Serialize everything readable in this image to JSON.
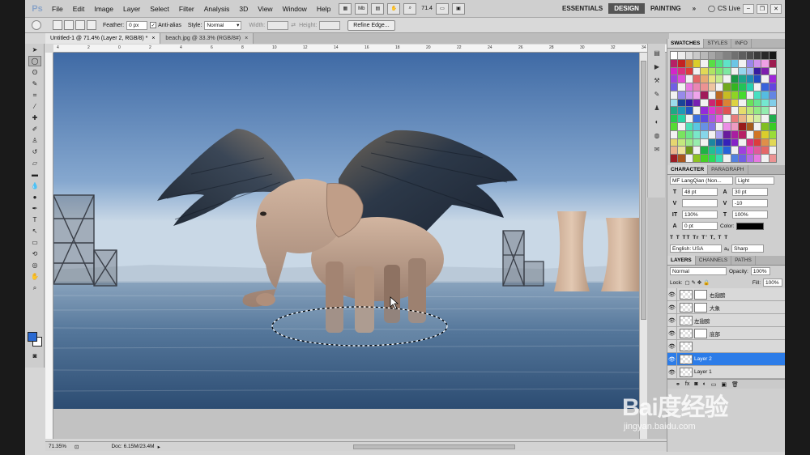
{
  "app": {
    "logo": "Ps"
  },
  "menu": [
    "File",
    "Edit",
    "Image",
    "Layer",
    "Select",
    "Filter",
    "Analysis",
    "3D",
    "View",
    "Window",
    "Help"
  ],
  "menubar": {
    "mb_label": "Mb",
    "zoom_value": "71.4",
    "workspaces": [
      "ESSENTIALS",
      "DESIGN",
      "PAINTING"
    ],
    "active_workspace": "DESIGN",
    "more": "»",
    "cs_live": "CS Live"
  },
  "options": {
    "feather_label": "Feather:",
    "feather_value": "0 px",
    "antialias_label": "Anti-alias",
    "style_label": "Style:",
    "style_value": "Normal",
    "width_label": "Width:",
    "height_label": "Height:",
    "refine_edge": "Refine Edge..."
  },
  "tabs": [
    {
      "label": "Untitled-1 @ 71.4% (Layer 2, RGB/8) *",
      "active": true
    },
    {
      "label": "beach.jpg @ 33.3% (RGB/8#)",
      "active": false
    }
  ],
  "ruler": [
    "4",
    "2",
    "0",
    "2",
    "4",
    "6",
    "8",
    "10",
    "12",
    "14",
    "16",
    "18",
    "20",
    "22",
    "24",
    "26",
    "28",
    "30",
    "32",
    "34"
  ],
  "status": {
    "zoom": "71.35%",
    "doc": "Doc: 6.15M/23.4M"
  },
  "swatches": {
    "tabs": [
      "SWATCHES",
      "STYLES",
      "INFO"
    ],
    "active": "SWATCHES"
  },
  "character": {
    "tabs": [
      "CHARACTER",
      "PARAGRAPH"
    ],
    "font_family": "MF LangQian (Non...",
    "font_style": "Light",
    "size": "48 pt",
    "leading": "30 pt",
    "tracking": "-10",
    "vscale": "130%",
    "hscale": "100%",
    "baseline": "0 pt",
    "color_label": "Color:",
    "language": "English: USA",
    "aa_label": "aₐ",
    "antialias": "Sharp",
    "text_styles": "T T TT Tr T' T, T T"
  },
  "layers": {
    "tabs": [
      "LAYERS",
      "CHANNELS",
      "PATHS"
    ],
    "blend_mode": "Normal",
    "opacity_label": "Opacity:",
    "opacity": "100%",
    "lock_label": "Lock:",
    "fill_label": "Fill:",
    "fill": "100%",
    "rows": [
      {
        "name": "右翅膀",
        "selected": false
      },
      {
        "name": "大象",
        "selected": false
      },
      {
        "name": "左翅膀",
        "selected": false
      },
      {
        "name": "底部",
        "selected": false
      },
      {
        "name": "",
        "selected": false
      },
      {
        "name": "Layer 2",
        "selected": true
      },
      {
        "name": "Layer 1",
        "selected": false
      }
    ],
    "footer": "fx"
  },
  "watermark": {
    "main": "Bai度经验",
    "sub": "jingyan.baidu.com"
  }
}
